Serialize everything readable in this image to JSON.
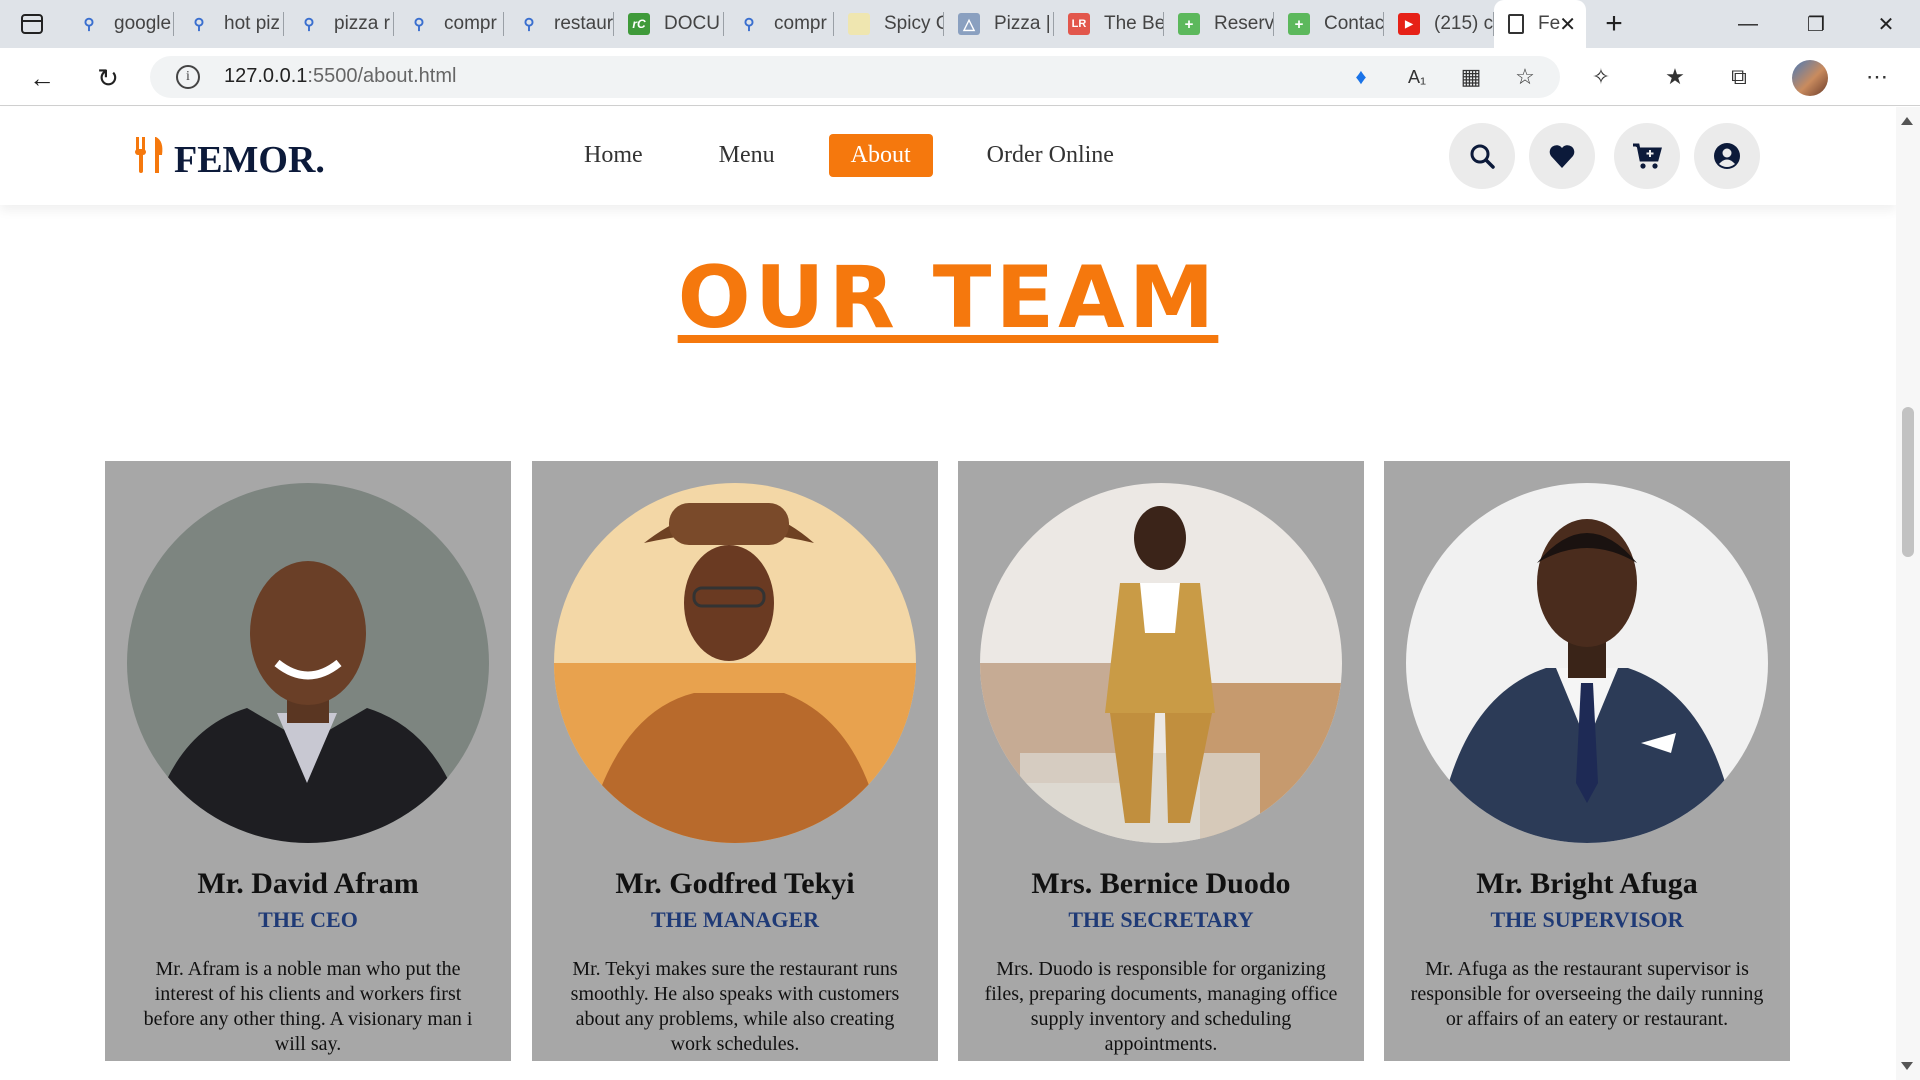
{
  "browser": {
    "tabs": [
      {
        "title": "google",
        "icon": "search-icon"
      },
      {
        "title": "hot piz",
        "icon": "search-icon"
      },
      {
        "title": "pizza r",
        "icon": "search-icon"
      },
      {
        "title": "compr",
        "icon": "search-icon"
      },
      {
        "title": "restaur",
        "icon": "search-icon"
      },
      {
        "title": "DOCU",
        "icon": "rc-icon"
      },
      {
        "title": "compr",
        "icon": "search-icon"
      },
      {
        "title": "Spicy C",
        "icon": "page-icon"
      },
      {
        "title": "Pizza |",
        "icon": "pizza-icon"
      },
      {
        "title": "The Be",
        "icon": "lr-icon"
      },
      {
        "title": "Reserv",
        "icon": "plus-icon"
      },
      {
        "title": "Contac",
        "icon": "plus-icon"
      },
      {
        "title": "(215) c",
        "icon": "youtube-icon"
      }
    ],
    "active_tab": {
      "title": "Fe",
      "icon": "document-icon"
    },
    "url_host": "127.0.0.1",
    "url_rest": ":5500/about.html"
  },
  "site": {
    "logo": "FEMOR.",
    "nav": [
      {
        "label": "Home",
        "active": false
      },
      {
        "label": "Menu",
        "active": false
      },
      {
        "label": "About",
        "active": true
      },
      {
        "label": "Order Online",
        "active": false
      }
    ],
    "accent": "#f5780d",
    "navy": "#0c1a3a"
  },
  "team": {
    "title": "OUR TEAM",
    "members": [
      {
        "name": "Mr. David Afram",
        "role": "THE CEO",
        "desc": "Mr. Afram is a noble man who put the interest of his clients and workers first before any other thing. A visionary man i will say."
      },
      {
        "name": "Mr. Godfred Tekyi",
        "role": "THE MANAGER",
        "desc": "Mr. Tekyi makes sure the restaurant runs smoothly. He also speaks with customers about any problems, while also creating work schedules."
      },
      {
        "name": "Mrs. Bernice Duodo",
        "role": "THE SECRETARY",
        "desc": "Mrs. Duodo is responsible for organizing files, preparing documents, managing office supply inventory and scheduling appointments."
      },
      {
        "name": "Mr. Bright Afuga",
        "role": "THE SUPERVISOR",
        "desc": "Mr. Afuga as the restaurant supervisor is responsible for overseeing the daily running or affairs of an eatery or restaurant."
      }
    ]
  }
}
